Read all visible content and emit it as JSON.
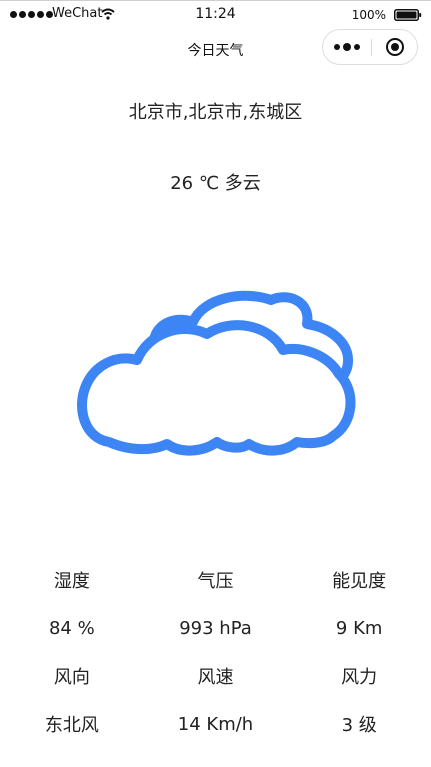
{
  "status_bar": {
    "carrier": "WeChat",
    "time": "11:24",
    "battery_percent": "100%",
    "icons": [
      "signal-icon",
      "wifi-icon",
      "battery-icon"
    ]
  },
  "titlebar": {
    "title": "今日天气",
    "capsule_icons": [
      "more-icon",
      "close-icon"
    ]
  },
  "weather": {
    "location": "北京市,北京市,东城区",
    "temperature": "26 ℃",
    "condition": "多云",
    "icon": "cloudy-icon",
    "icon_color": "#3D85F5"
  },
  "stats": {
    "labels_row1": [
      "湿度",
      "气压",
      "能见度"
    ],
    "values_row1": [
      "84 %",
      "993 hPa",
      "9 Km"
    ],
    "labels_row2": [
      "风向",
      "风速",
      "风力"
    ],
    "values_row2": [
      "东北风",
      "14 Km/h",
      "3 级"
    ]
  }
}
